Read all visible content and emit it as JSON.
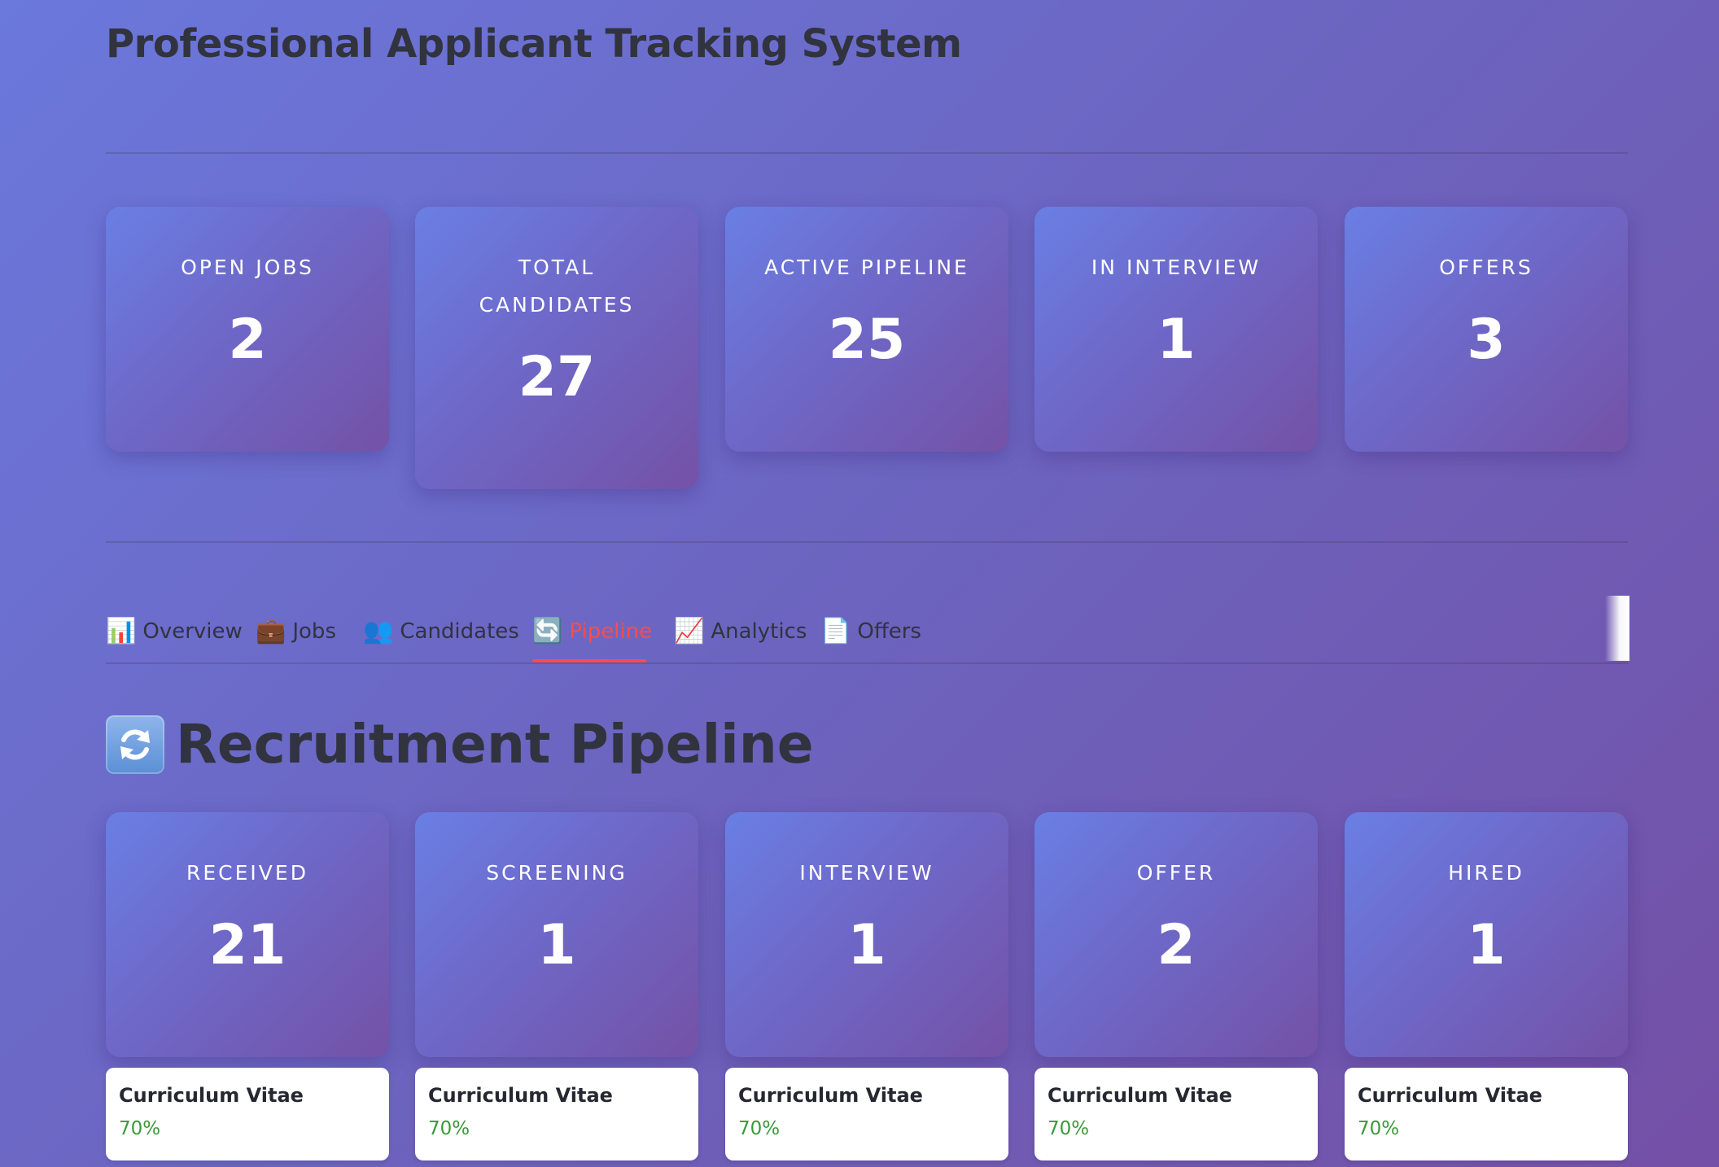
{
  "app": {
    "title": "Professional Applicant Tracking System"
  },
  "metrics": [
    {
      "label": "OPEN JOBS",
      "value": "2"
    },
    {
      "label": "TOTAL CANDIDATES",
      "value": "27"
    },
    {
      "label": "ACTIVE PIPELINE",
      "value": "25"
    },
    {
      "label": "IN INTERVIEW",
      "value": "1"
    },
    {
      "label": "OFFERS",
      "value": "3"
    }
  ],
  "tabs": [
    {
      "icon": "📊",
      "label": "Overview",
      "icon_name": "bar-chart-icon"
    },
    {
      "icon": "💼",
      "label": "Jobs",
      "icon_name": "briefcase-icon"
    },
    {
      "icon": "👥",
      "label": "Candidates",
      "icon_name": "people-icon"
    },
    {
      "icon": "🔄",
      "label": "Pipeline",
      "icon_name": "refresh-icon"
    },
    {
      "icon": "📈",
      "label": "Analytics",
      "icon_name": "line-chart-icon"
    },
    {
      "icon": "📄",
      "label": "Offers",
      "icon_name": "document-icon"
    }
  ],
  "active_tab": "Pipeline",
  "pipeline": {
    "icon": "🔄",
    "icon_name": "refresh-icon",
    "title": "Recruitment Pipeline",
    "stages": [
      {
        "label": "RECEIVED",
        "count": "21"
      },
      {
        "label": "SCREENING",
        "count": "1"
      },
      {
        "label": "INTERVIEW",
        "count": "1"
      },
      {
        "label": "OFFER",
        "count": "2"
      },
      {
        "label": "HIRED",
        "count": "1"
      }
    ],
    "candidates": [
      {
        "name": "Curriculum Vitae",
        "score": "70%"
      },
      {
        "name": "Curriculum Vitae",
        "score": "70%"
      },
      {
        "name": "Curriculum Vitae",
        "score": "70%"
      },
      {
        "name": "Curriculum Vitae",
        "score": "70%"
      },
      {
        "name": "Curriculum Vitae",
        "score": "70%"
      }
    ]
  },
  "colors": {
    "accent_active_tab": "#ff4b4b",
    "score_green": "#3a9a3a",
    "heading_text": "#31333f"
  }
}
